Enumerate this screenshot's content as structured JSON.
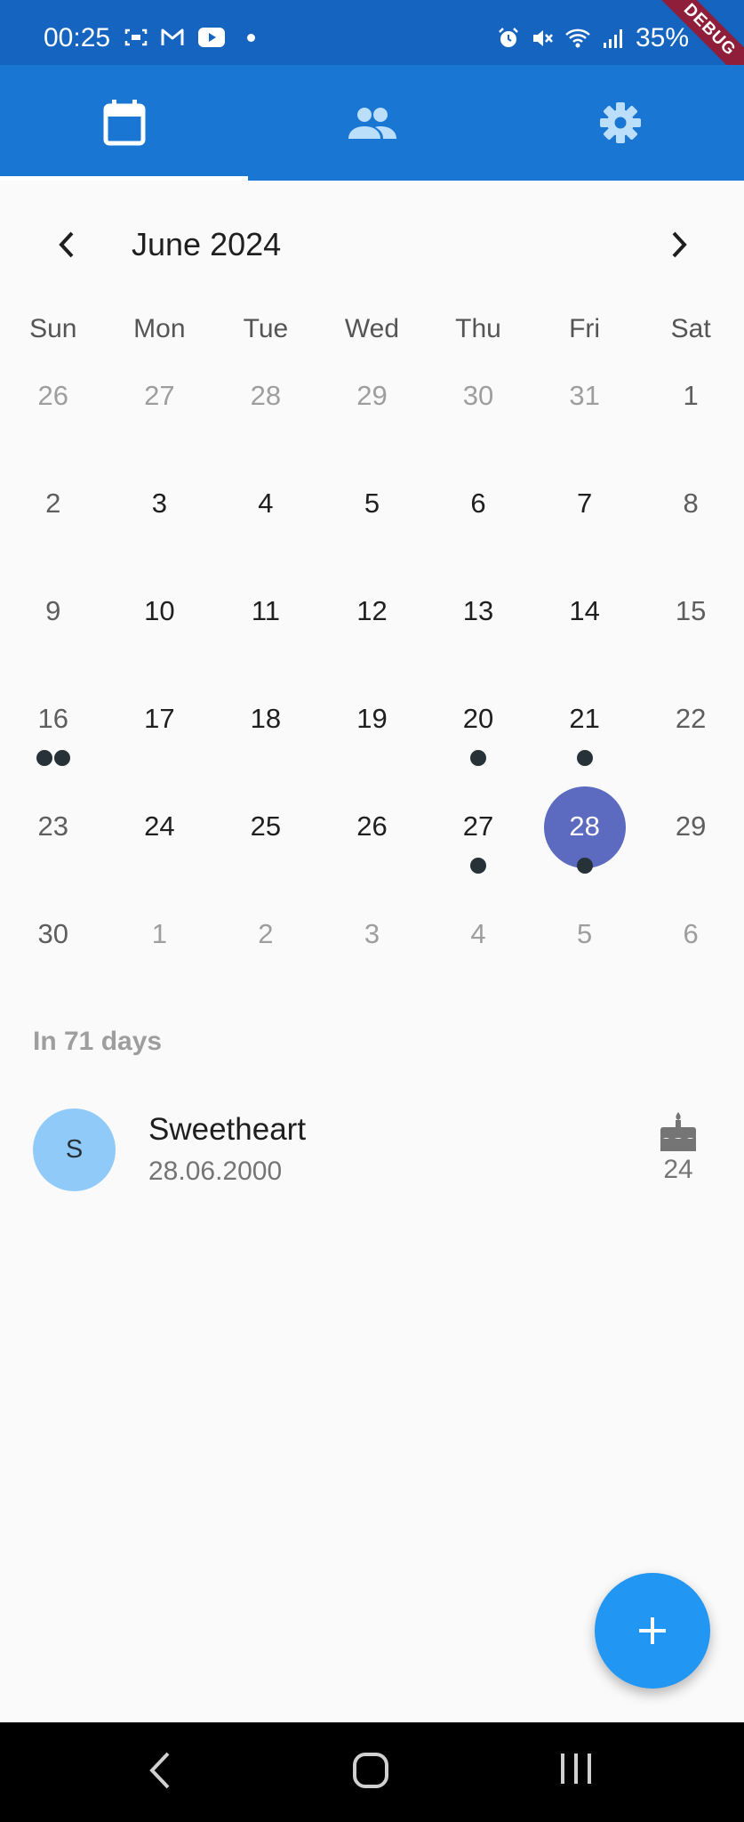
{
  "status_bar": {
    "time": "00:25",
    "battery": "35%",
    "left_icons": [
      "screen-record-icon",
      "gmail-icon",
      "youtube-icon",
      "notification-dot-icon"
    ],
    "right_icons": [
      "alarm-icon",
      "mute-icon",
      "wifi-icon",
      "signal-icon"
    ],
    "debug_banner": "DEBUG"
  },
  "tabs": [
    {
      "icon": "calendar-icon",
      "active": true
    },
    {
      "icon": "people-icon",
      "active": false
    },
    {
      "icon": "settings-gear-icon",
      "active": false
    }
  ],
  "calendar": {
    "month_title": "June 2024",
    "weekdays": [
      "Sun",
      "Mon",
      "Tue",
      "Wed",
      "Thu",
      "Fri",
      "Sat"
    ],
    "selected_day": "28",
    "weeks": [
      [
        {
          "d": "26",
          "out": true
        },
        {
          "d": "27",
          "out": true
        },
        {
          "d": "28",
          "out": true
        },
        {
          "d": "29",
          "out": true
        },
        {
          "d": "30",
          "out": true
        },
        {
          "d": "31",
          "out": true
        },
        {
          "d": "1"
        }
      ],
      [
        {
          "d": "2"
        },
        {
          "d": "3"
        },
        {
          "d": "4"
        },
        {
          "d": "5"
        },
        {
          "d": "6"
        },
        {
          "d": "7"
        },
        {
          "d": "8"
        }
      ],
      [
        {
          "d": "9"
        },
        {
          "d": "10"
        },
        {
          "d": "11"
        },
        {
          "d": "12"
        },
        {
          "d": "13"
        },
        {
          "d": "14"
        },
        {
          "d": "15"
        }
      ],
      [
        {
          "d": "16",
          "events": 2
        },
        {
          "d": "17"
        },
        {
          "d": "18"
        },
        {
          "d": "19"
        },
        {
          "d": "20",
          "events": 1
        },
        {
          "d": "21",
          "events": 1
        },
        {
          "d": "22"
        }
      ],
      [
        {
          "d": "23"
        },
        {
          "d": "24"
        },
        {
          "d": "25"
        },
        {
          "d": "26"
        },
        {
          "d": "27",
          "events": 1
        },
        {
          "d": "28",
          "events": 1,
          "selected": true
        },
        {
          "d": "29"
        }
      ],
      [
        {
          "d": "30"
        },
        {
          "d": "1",
          "out": true
        },
        {
          "d": "2",
          "out": true
        },
        {
          "d": "3",
          "out": true
        },
        {
          "d": "4",
          "out": true
        },
        {
          "d": "5",
          "out": true
        },
        {
          "d": "6",
          "out": true
        }
      ]
    ]
  },
  "upcoming": {
    "label": "In 71 days",
    "event": {
      "avatar_letter": "S",
      "name": "Sweetheart",
      "date": "28.06.2000",
      "age": "24",
      "icon": "birthday-cake-icon"
    }
  },
  "fab": {
    "icon": "plus-icon"
  },
  "nav_bar": {
    "icons": [
      "back-icon",
      "home-icon",
      "recent-apps-icon"
    ]
  },
  "colors": {
    "status_bar": "#1565c0",
    "app_bar": "#1976d2",
    "selected_day": "#5c6bc0",
    "avatar": "#90caf9",
    "fab": "#2196f3",
    "event_marker": "#263238"
  }
}
